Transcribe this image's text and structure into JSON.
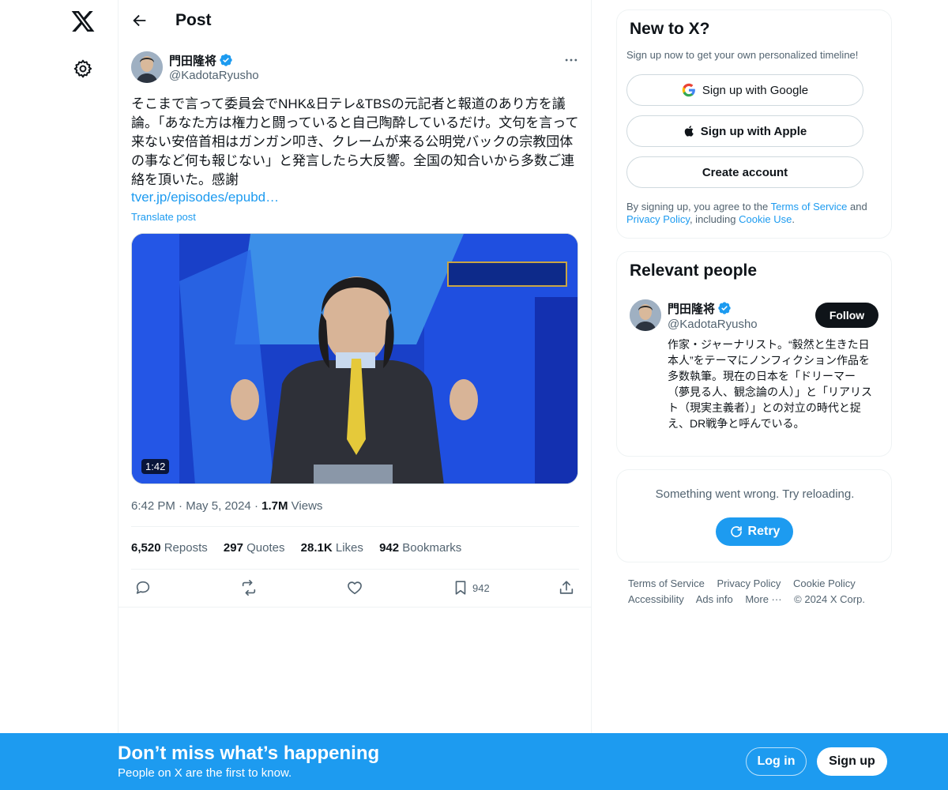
{
  "header": {
    "title": "Post"
  },
  "tweet": {
    "author_name": "門田隆将",
    "author_handle": "@KadotaRyusho",
    "text": "そこまで言って委員会でNHK&日テレ&TBSの元記者と報道のあり方を議論。「あなた方は権力と闘っていると自己陶酔しているだけ。文句を言って来ない安倍首相はガンガン叩き、クレームが来る公明党バックの宗教団体の事など何も報じない」と発言したら大反響。全国の知合いから多数ご連絡を頂いた。感謝",
    "link": "tver.jp/episodes/epubd…",
    "translate": "Translate post",
    "video_duration": "1:42",
    "time": "6:42 PM",
    "date": "May 5, 2024",
    "views_count": "1.7M",
    "views_label": "Views",
    "reposts_count": "6,520",
    "reposts_label": "Reposts",
    "quotes_count": "297",
    "quotes_label": "Quotes",
    "likes_count": "28.1K",
    "likes_label": "Likes",
    "bookmarks_count": "942",
    "bookmarks_label": "Bookmarks",
    "bookmark_action_count": "942"
  },
  "signup_card": {
    "title": "New to X?",
    "subtitle": "Sign up now to get your own personalized timeline!",
    "google": "Sign up with Google",
    "apple": "Sign up with Apple",
    "create": "Create account",
    "legal_1": "By signing up, you agree to the ",
    "tos": "Terms of Service",
    "legal_2": " and ",
    "privacy": "Privacy Policy",
    "legal_3": ", including ",
    "cookie": "Cookie Use",
    "legal_4": "."
  },
  "relevant": {
    "title": "Relevant people",
    "name": "門田隆将",
    "handle": "@KadotaRyusho",
    "follow": "Follow",
    "bio": "作家・ジャーナリスト。“毅然と生きた日本人”をテーマにノンフィクション作品を多数執筆。現在の日本を「ドリーマー（夢見る人、観念論の人）」と「リアリスト（現実主義者）」との対立の時代と捉え、DR戦争と呼んでいる。"
  },
  "error_card": {
    "message": "Something went wrong. Try reloading.",
    "retry": "Retry"
  },
  "footer": {
    "tos": "Terms of Service",
    "privacy": "Privacy Policy",
    "cookie": "Cookie Policy",
    "accessibility": "Accessibility",
    "ads": "Ads info",
    "more": "More ···",
    "copyright": "© 2024 X Corp."
  },
  "banner": {
    "title": "Don’t miss what’s happening",
    "subtitle": "People on X are the first to know.",
    "login": "Log in",
    "signup": "Sign up"
  },
  "colors": {
    "accent": "#1d9bf0",
    "text": "#0f1419",
    "muted": "#536471"
  }
}
